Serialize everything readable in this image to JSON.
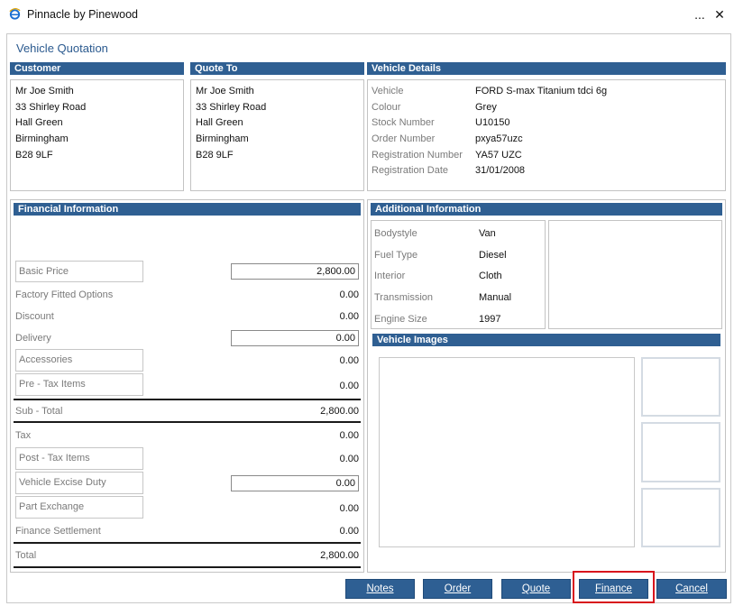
{
  "window": {
    "title": "Pinnacle by Pinewood",
    "menu_glyph": "...",
    "close_glyph": "✕"
  },
  "page": {
    "heading": "Vehicle Quotation"
  },
  "customer": {
    "header": "Customer",
    "lines": [
      "Mr Joe Smith",
      "33 Shirley Road",
      "Hall Green",
      "Birmingham",
      "B28 9LF"
    ]
  },
  "quote_to": {
    "header": "Quote To",
    "lines": [
      "Mr Joe Smith",
      "33 Shirley Road",
      "Hall Green",
      "Birmingham",
      "B28 9LF"
    ]
  },
  "vehicle_details": {
    "header": "Vehicle Details",
    "rows": [
      {
        "label": "Vehicle",
        "value": "FORD S-max Titanium tdci 6g"
      },
      {
        "label": "Colour",
        "value": "Grey"
      },
      {
        "label": "Stock Number",
        "value": "U10150"
      },
      {
        "label": "Order Number",
        "value": "pxya57uzc"
      },
      {
        "label": "Registration Number",
        "value": "YA57 UZC"
      },
      {
        "label": "Registration Date",
        "value": "31/01/2008"
      }
    ]
  },
  "financial": {
    "header": "Financial Information",
    "basic_price": {
      "label": "Basic Price",
      "value": "2,800.00"
    },
    "factory_options": {
      "label": "Factory Fitted Options",
      "value": "0.00"
    },
    "discount": {
      "label": "Discount",
      "value": "0.00"
    },
    "delivery": {
      "label": "Delivery",
      "value": "0.00"
    },
    "accessories": {
      "label": "Accessories",
      "value": "0.00"
    },
    "pre_tax": {
      "label": "Pre - Tax Items",
      "value": "0.00"
    },
    "sub_total": {
      "label": "Sub - Total",
      "value": "2,800.00"
    },
    "tax": {
      "label": "Tax",
      "value": "0.00"
    },
    "post_tax": {
      "label": "Post - Tax Items",
      "value": "0.00"
    },
    "excise": {
      "label": "Vehicle Excise Duty",
      "value": "0.00"
    },
    "part_exchange": {
      "label": "Part Exchange",
      "value": "0.00"
    },
    "finance_settlement": {
      "label": "Finance Settlement",
      "value": "0.00"
    },
    "total": {
      "label": "Total",
      "value": "2,800.00"
    }
  },
  "additional": {
    "header": "Additional Information",
    "rows": [
      {
        "label": "Bodystyle",
        "value": "Van"
      },
      {
        "label": "Fuel Type",
        "value": "Diesel"
      },
      {
        "label": "Interior",
        "value": "Cloth"
      },
      {
        "label": "Transmission",
        "value": "Manual"
      },
      {
        "label": "Engine Size",
        "value": "1997"
      }
    ]
  },
  "images": {
    "header": "Vehicle Images"
  },
  "buttons": {
    "notes": "Notes",
    "order": "Order",
    "quote": "Quote",
    "finance": "Finance",
    "cancel": "Cancel"
  },
  "colors": {
    "header_blue": "#2f5f92",
    "highlight_red": "#d8141c"
  }
}
